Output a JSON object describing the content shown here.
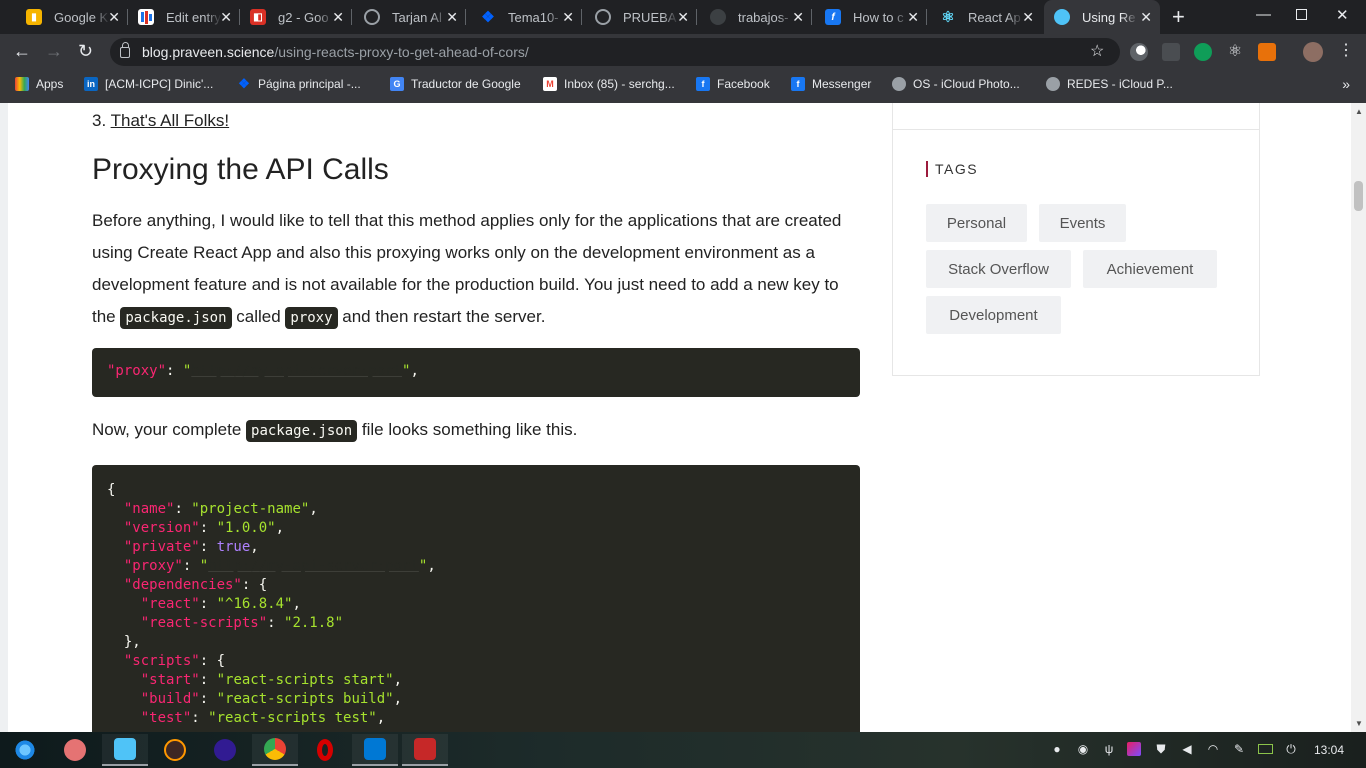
{
  "tabs": [
    {
      "title": "Google K",
      "favicon": "keep-icon",
      "color": "#f6b400"
    },
    {
      "title": "Edit entry",
      "favicon": "chart-icon",
      "color": "#1a73e8"
    },
    {
      "title": "g2 - Goo",
      "favicon": "slides-icon",
      "color": "#d93025"
    },
    {
      "title": "Tarjan Al",
      "favicon": "globe-icon",
      "color": "#9aa0a6"
    },
    {
      "title": "Tema10-",
      "favicon": "dropbox-icon",
      "color": "#0061fe"
    },
    {
      "title": "PRUEBA",
      "favicon": "globe-icon",
      "color": "#9aa0a6"
    },
    {
      "title": "trabajos-",
      "favicon": "github-icon",
      "color": "#24292e"
    },
    {
      "title": "How to c",
      "favicon": "f-icon",
      "color": "#1877f2"
    },
    {
      "title": "React Ap",
      "favicon": "react-icon",
      "color": "#61dafb"
    },
    {
      "title": "Using Re",
      "favicon": "cloud-icon",
      "color": "#4fc3f7",
      "active": true
    }
  ],
  "address": {
    "host": "blog.praveen.science",
    "path": "/using-reacts-proxy-to-get-ahead-of-cors/"
  },
  "bookmarks": [
    {
      "label": "Apps",
      "icon": "apps-grid-icon",
      "color": "#ea4335"
    },
    {
      "label": "[ACM-ICPC] Dinic'...",
      "icon": "linkedin-icon",
      "color": "#0a66c2"
    },
    {
      "label": "Página principal -...",
      "icon": "dropbox-icon",
      "color": "#0061fe"
    },
    {
      "label": "Traductor de Google",
      "icon": "translate-icon",
      "color": "#4285f4"
    },
    {
      "label": "Inbox (85) - serchg...",
      "icon": "gmail-icon",
      "color": "#ea4335"
    },
    {
      "label": "Facebook",
      "icon": "facebook-icon",
      "color": "#1877f2"
    },
    {
      "label": "Messenger",
      "icon": "facebook-icon",
      "color": "#1877f2"
    },
    {
      "label": "OS - iCloud Photo...",
      "icon": "apple-icon",
      "color": "#9aa0a6"
    },
    {
      "label": "REDES - iCloud P...",
      "icon": "apple-icon",
      "color": "#9aa0a6"
    }
  ],
  "article": {
    "list_num": "3.",
    "list_link": "That's All Folks!",
    "heading": "Proxying the API Calls",
    "para1_a": "Before anything, I would like to tell that this method applies only for the applications that are created using Create React App and also this proxying works only on the development environment as a development feature and is not available for the production build. You just need to add a new key to the ",
    "para1_code1": "package.json",
    "para1_b": " called ",
    "para1_code2": "proxy",
    "para1_c": " and then restart the server.",
    "para2_a": "Now, your complete ",
    "para2_code": "package.json",
    "para2_b": " file looks something like this.",
    "block1_key": "\"proxy\"",
    "block1_val": "http://my-api-server:port"
  },
  "sidebar": {
    "heading": "TAGS",
    "tags": [
      "Personal",
      "Events",
      "Stack Overflow",
      "Achievement",
      "Development"
    ]
  },
  "taskbar": {
    "apps": [
      "deepin-icon",
      "recorder-icon",
      "files-icon",
      "sublime-icon",
      "monitor-icon",
      "chrome-icon",
      "opera-icon",
      "vscode-icon",
      "terminal-icon"
    ],
    "clock": "13:04"
  }
}
